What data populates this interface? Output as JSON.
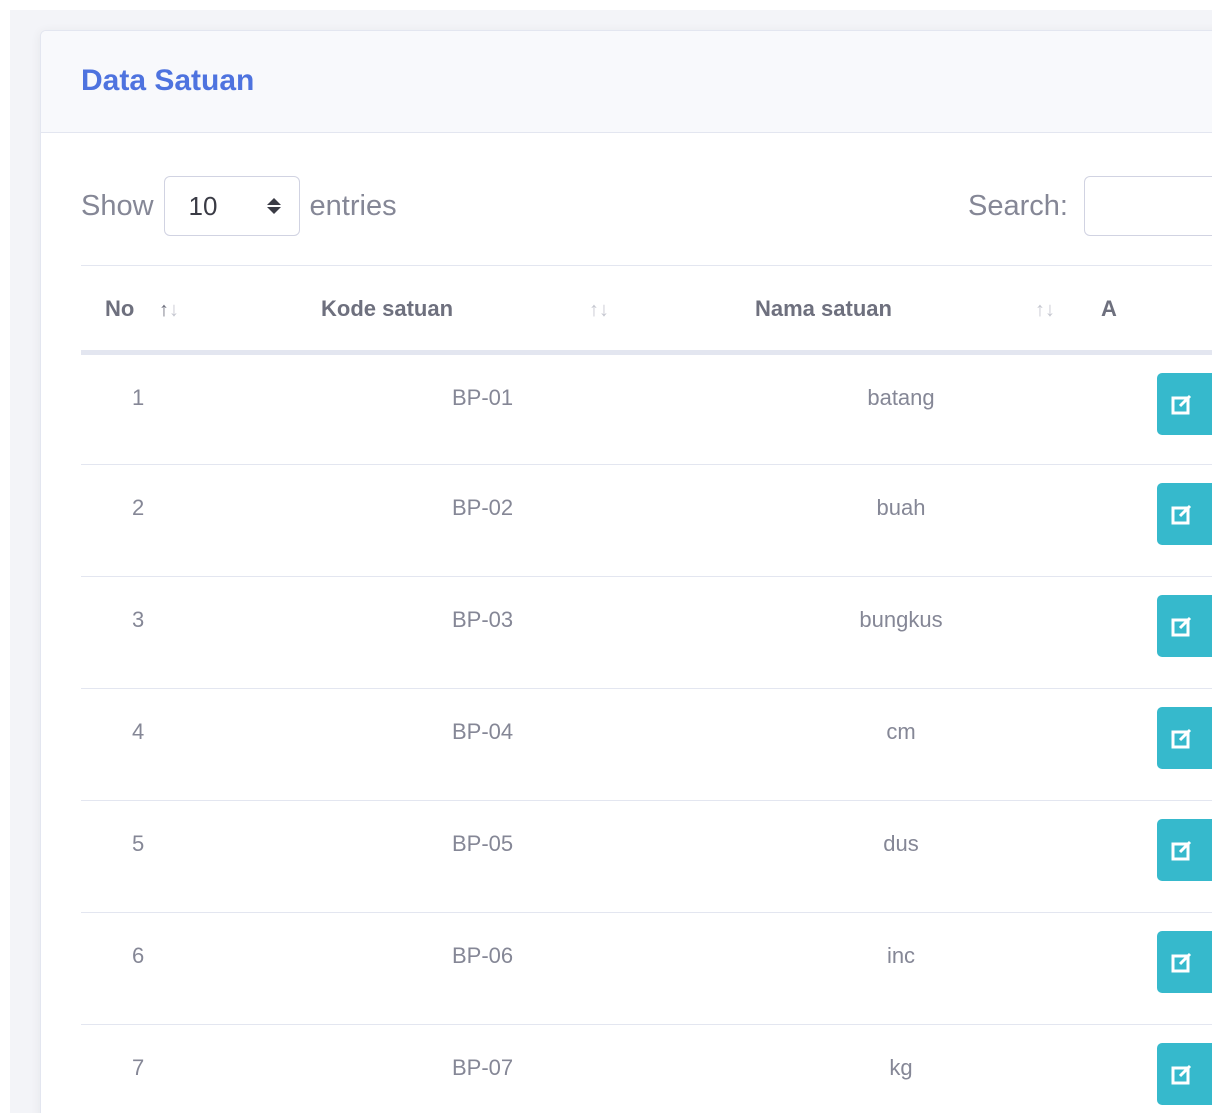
{
  "card": {
    "title": "Data Satuan"
  },
  "length_control": {
    "show_label": "Show",
    "selected": "10",
    "entries_label": "entries"
  },
  "search": {
    "label": "Search:",
    "value": "",
    "placeholder": ""
  },
  "table": {
    "columns": [
      "No",
      "Kode satuan",
      "Nama satuan",
      "A"
    ],
    "rows": [
      {
        "no": "1",
        "kode": "BP-01",
        "nama": "batang"
      },
      {
        "no": "2",
        "kode": "BP-02",
        "nama": "buah"
      },
      {
        "no": "3",
        "kode": "BP-03",
        "nama": "bungkus"
      },
      {
        "no": "4",
        "kode": "BP-04",
        "nama": "cm"
      },
      {
        "no": "5",
        "kode": "BP-05",
        "nama": "dus"
      },
      {
        "no": "6",
        "kode": "BP-06",
        "nama": "inc"
      },
      {
        "no": "7",
        "kode": "BP-07",
        "nama": "kg"
      }
    ]
  },
  "icons": {
    "sort": "sort-arrows-icon",
    "edit": "edit-icon"
  },
  "colors": {
    "title": "#4e73df",
    "edit_button": "#36b9cc"
  }
}
